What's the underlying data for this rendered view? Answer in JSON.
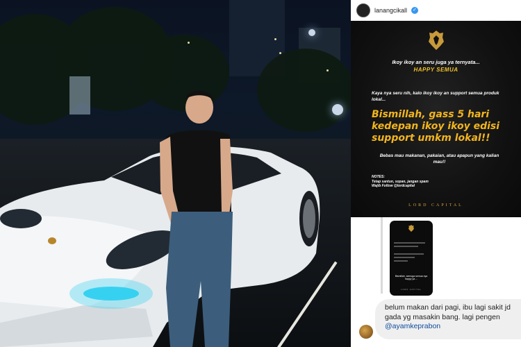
{
  "instagram": {
    "username": "lanangcikall",
    "verified_icon": "verified-badge-icon"
  },
  "story": {
    "line1": "Ikoy ikoy an seru juga ya ternyata...",
    "line2": "HAPPY SEMUA",
    "text1": "Kaya nya seru nih, kalo ikoy ikoy an support semua produk lokal...",
    "big_text": "Bismillah, gass 5 hari kedepan ikoy ikoy edisi support umkm lokal!!",
    "text2": "Bebas mau makanan, pakaian, atau apapun yang kalian mau!!",
    "notes_title": "NOTES:",
    "notes_line1": "Tetap santun, sopan, jangan spam",
    "notes_line2": "Wajib Follow @lordcapital",
    "brand": "LORD CAPITAL"
  },
  "dm": {
    "mini_story_line": "Bismillah, semoga semua nya happy ya ...",
    "mini_brand": "LORD CAPITAL",
    "message_line1": "belum makan dari pagi, ibu lagi sakit jd",
    "message_line2": "gada yg masakin bang. lagi pengen",
    "message_mention": "@ayamkeprabon"
  },
  "colors": {
    "story_gold": "#f3b51d",
    "mention_blue": "#0c4a9d",
    "verified_blue": "#3897f0"
  }
}
